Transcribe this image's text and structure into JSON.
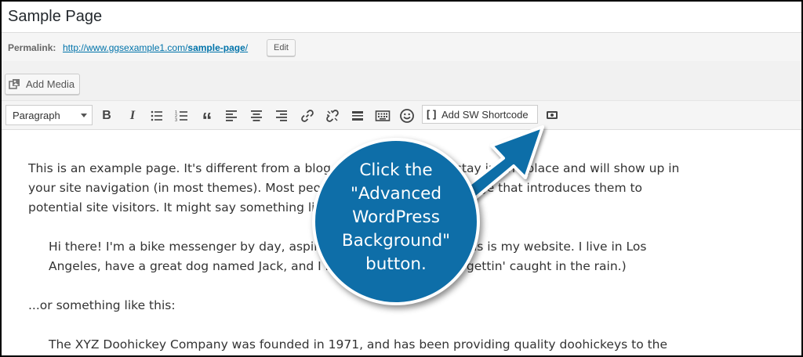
{
  "page": {
    "title": "Sample Page"
  },
  "permalink": {
    "label": "Permalink:",
    "url_prefix": "http://www.ggsexample1.com/",
    "url_slug": "sample-page",
    "url_suffix": "/",
    "edit_label": "Edit"
  },
  "media": {
    "add_media_label": "Add Media"
  },
  "toolbar": {
    "format_value": "Paragraph",
    "buttons": [
      {
        "name": "bold",
        "glyph": "B"
      },
      {
        "name": "italic",
        "glyph": "I"
      },
      {
        "name": "bulleted-list",
        "icon": "bulleted-list-icon"
      },
      {
        "name": "numbered-list",
        "icon": "numbered-list-icon"
      },
      {
        "name": "blockquote",
        "glyph": "“"
      },
      {
        "name": "align-left",
        "icon": "align-left-icon"
      },
      {
        "name": "align-center",
        "icon": "align-center-icon"
      },
      {
        "name": "align-right",
        "icon": "align-right-icon"
      },
      {
        "name": "insert-link",
        "icon": "link-icon"
      },
      {
        "name": "remove-link",
        "icon": "unlink-icon"
      },
      {
        "name": "read-more",
        "icon": "read-more-icon"
      },
      {
        "name": "toolbar-toggle",
        "icon": "keyboard-icon"
      },
      {
        "name": "emoji",
        "icon": "smiley-icon"
      }
    ],
    "sw_shortcode_label": "Add SW Shortcode",
    "sw_shortcode_glyph": "[ ]",
    "advanced_bg_icon": "advanced-wordpress-background-icon"
  },
  "content": {
    "p1": [
      "This is an example page. It's different from a blog post because it will stay in one place and will show up in",
      "your site navigation (in most themes). Most people start with an About page that introduces them to",
      "potential site visitors. It might say something like this:"
    ],
    "quote1": [
      "Hi there! I'm a bike messenger by day, aspiring actor by night, and this is my website. I live in Los",
      "Angeles, have a great dog named Jack, and I like piña coladas. (And gettin' caught in the rain.)"
    ],
    "p2": "...or something like this:",
    "quote2": "The XYZ Doohickey Company was founded in 1971, and has been providing quality doohickeys to the"
  },
  "callout": {
    "lines": [
      "Click the",
      "\"Advanced",
      "WordPress",
      "Background\"",
      "button."
    ],
    "color": "#0e6ea8"
  }
}
